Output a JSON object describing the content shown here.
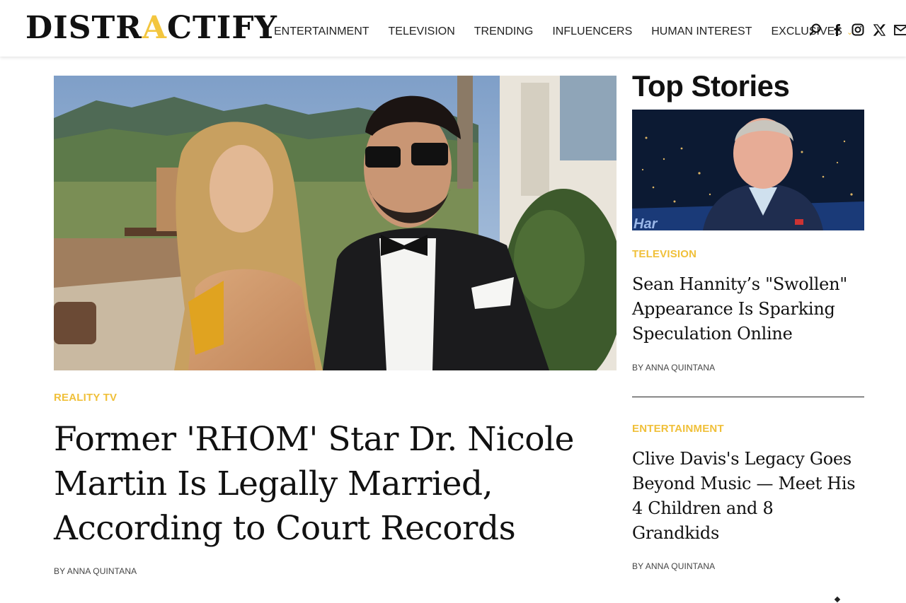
{
  "site": {
    "logo_text_a": "DISTR",
    "logo_text_b": "A",
    "logo_text_c": "CTIFY"
  },
  "nav": {
    "items": [
      {
        "label": "ENTERTAINMENT"
      },
      {
        "label": "TELEVISION"
      },
      {
        "label": "TRENDING"
      },
      {
        "label": "INFLUENCERS"
      },
      {
        "label": "HUMAN INTEREST"
      },
      {
        "label": "EXCLUSIVES"
      }
    ],
    "icons": [
      "search-icon",
      "facebook-icon",
      "instagram-icon",
      "x-icon",
      "email-icon"
    ]
  },
  "main_story": {
    "category": "REALITY TV",
    "title": "Former 'RHOM' Star Dr. Nicole Martin Is Legally Married, According to Court Records",
    "byline": "BY ANNA QUINTANA"
  },
  "sidebar": {
    "heading": "Top Stories",
    "stories": [
      {
        "category": "TELEVISION",
        "title": "Sean Hannity’s \"Swollen\" Appearance Is Sparking Speculation Online",
        "byline": "BY ANNA QUINTANA",
        "image_caption_text": "Har"
      },
      {
        "category": "ENTERTAINMENT",
        "title": "Clive Davis's Legacy Goes Beyond Music — Meet His 4 Children and 8 Grandkids",
        "byline": "BY ANNA QUINTANA"
      }
    ]
  },
  "colors": {
    "accent": "#f0c03a",
    "text": "#111111",
    "divider": "#222222"
  }
}
